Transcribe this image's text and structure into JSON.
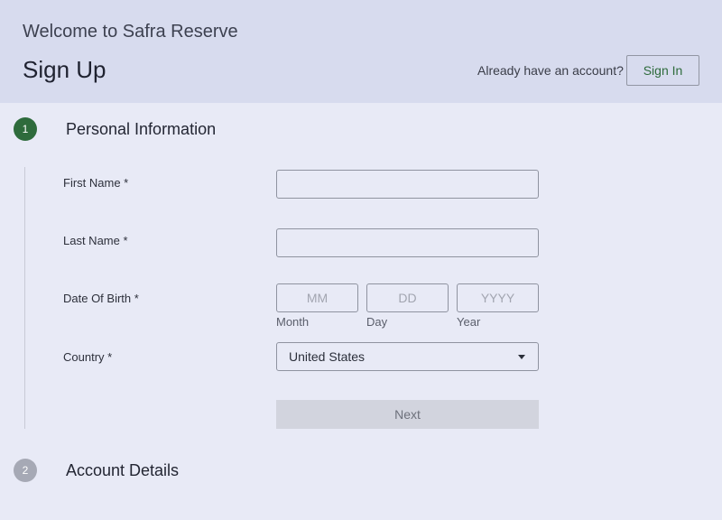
{
  "header": {
    "welcome": "Welcome to Safra Reserve",
    "title": "Sign Up",
    "already_text": "Already have an account?",
    "signin_label": "Sign In"
  },
  "steps": [
    {
      "number": "1",
      "title": "Personal Information"
    },
    {
      "number": "2",
      "title": "Account Details"
    }
  ],
  "form": {
    "first_name": {
      "label": "First Name *",
      "value": ""
    },
    "last_name": {
      "label": "Last Name *",
      "value": ""
    },
    "dob": {
      "label": "Date Of Birth *",
      "month": {
        "placeholder": "MM",
        "helper": "Month"
      },
      "day": {
        "placeholder": "DD",
        "helper": "Day"
      },
      "year": {
        "placeholder": "YYYY",
        "helper": "Year"
      }
    },
    "country": {
      "label": "Country *",
      "value": "United States"
    },
    "next_label": "Next"
  },
  "colors": {
    "accent": "#2e6b3c",
    "inactive_step": "#a6a9b5",
    "header_bg": "#d7dbee",
    "page_bg": "#e8eaf6"
  }
}
